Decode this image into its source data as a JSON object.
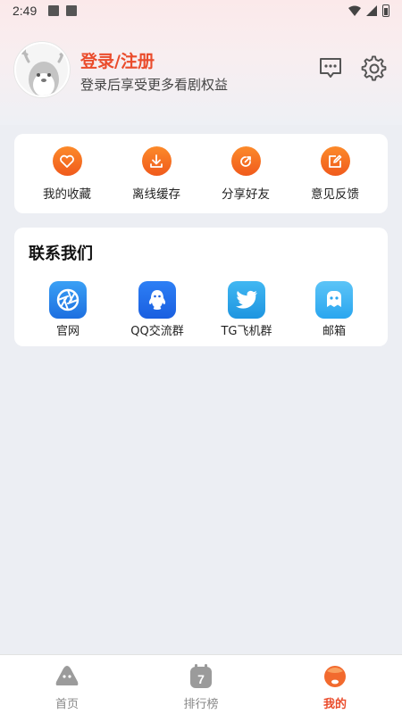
{
  "status_bar": {
    "time": "2:49"
  },
  "profile": {
    "login_title": "登录/注册",
    "login_subtitle": "登录后享受更多看剧权益"
  },
  "colors": {
    "accent": "#ea4c2c",
    "orange": "#f5712a",
    "background": "#eceef3"
  },
  "quick_actions": [
    {
      "label": "我的收藏",
      "icon": "heart-icon"
    },
    {
      "label": "离线缓存",
      "icon": "download-icon"
    },
    {
      "label": "分享好友",
      "icon": "share-icon"
    },
    {
      "label": "意见反馈",
      "icon": "edit-icon"
    }
  ],
  "contact": {
    "title": "联系我们",
    "items": [
      {
        "label": "官网",
        "icon": "aperture-icon"
      },
      {
        "label": "QQ交流群",
        "icon": "qq-icon"
      },
      {
        "label": "TG飞机群",
        "icon": "twitter-bird-icon"
      },
      {
        "label": "邮箱",
        "icon": "chat-bubble-icon"
      }
    ]
  },
  "tabs": [
    {
      "label": "首页",
      "icon": "home-icon",
      "active": false
    },
    {
      "label": "排行榜",
      "icon": "ranking-icon",
      "active": false
    },
    {
      "label": "我的",
      "icon": "profile-icon",
      "active": true
    }
  ],
  "ranking_icon_number": "7"
}
